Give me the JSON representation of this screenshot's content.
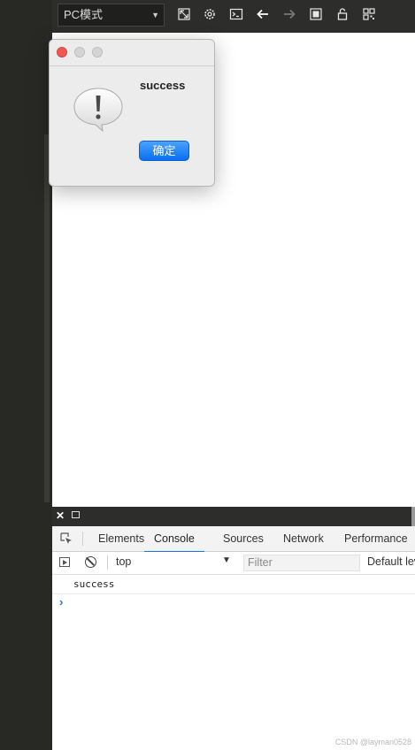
{
  "toolbar": {
    "mode_select": "PC模式",
    "icons": [
      "resize-icon",
      "gear-icon",
      "terminal-icon",
      "back-arrow-icon",
      "forward-arrow-icon",
      "screen-icon",
      "lock-icon",
      "qr-grid-icon"
    ]
  },
  "dialog": {
    "message": "success",
    "ok_label": "确定",
    "icon": "alert-speech-bubble-icon"
  },
  "devtools": {
    "tabs": [
      {
        "label": "Elements",
        "active": false
      },
      {
        "label": "Console",
        "active": true
      },
      {
        "label": "Sources",
        "active": false
      },
      {
        "label": "Network",
        "active": false
      },
      {
        "label": "Performance",
        "active": false
      }
    ],
    "context": "top",
    "filter_placeholder": "Filter",
    "levels": "Default levels",
    "logs": [
      "success"
    ],
    "prompt": "›"
  },
  "watermark": "CSDN @layman0528",
  "colors": {
    "accent": "#1a73e8",
    "dialog_button": "#0a6ff0",
    "close_dot": "#ee5a52"
  }
}
